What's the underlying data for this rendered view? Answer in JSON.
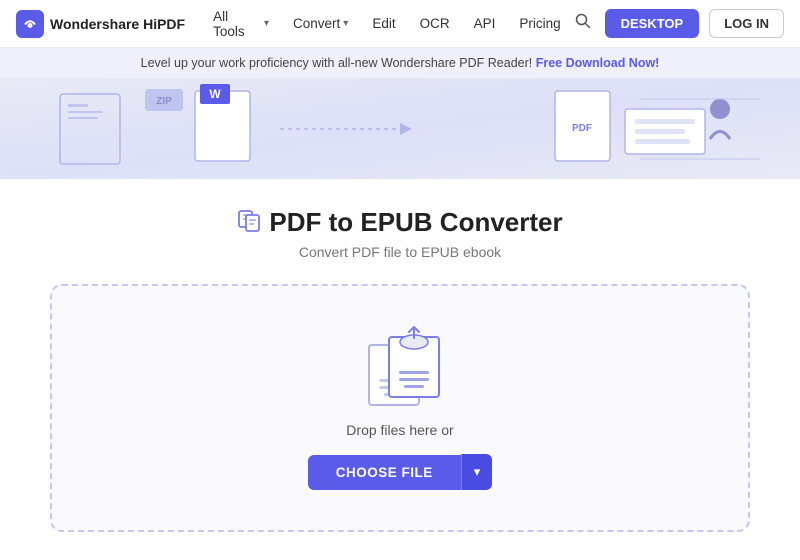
{
  "nav": {
    "logo_text": "Wondershare HiPDF",
    "logo_icon": "W",
    "items": [
      {
        "label": "All Tools",
        "has_chevron": true
      },
      {
        "label": "Convert",
        "has_chevron": true
      },
      {
        "label": "Edit",
        "has_chevron": false
      },
      {
        "label": "OCR",
        "has_chevron": false
      },
      {
        "label": "API",
        "has_chevron": false
      },
      {
        "label": "Pricing",
        "has_chevron": false
      }
    ],
    "desktop_btn": "DESKTOP",
    "login_btn": "LOG IN"
  },
  "banner": {
    "text": "Level up your work proficiency with all-new Wondershare PDF Reader!",
    "link_text": "Free Download Now!"
  },
  "page": {
    "title": "PDF to EPUB Converter",
    "subtitle": "Convert PDF file to EPUB ebook"
  },
  "dropzone": {
    "label": "Drop files here or",
    "choose_btn": "CHOOSE FILE",
    "dropdown_icon": "▾"
  }
}
